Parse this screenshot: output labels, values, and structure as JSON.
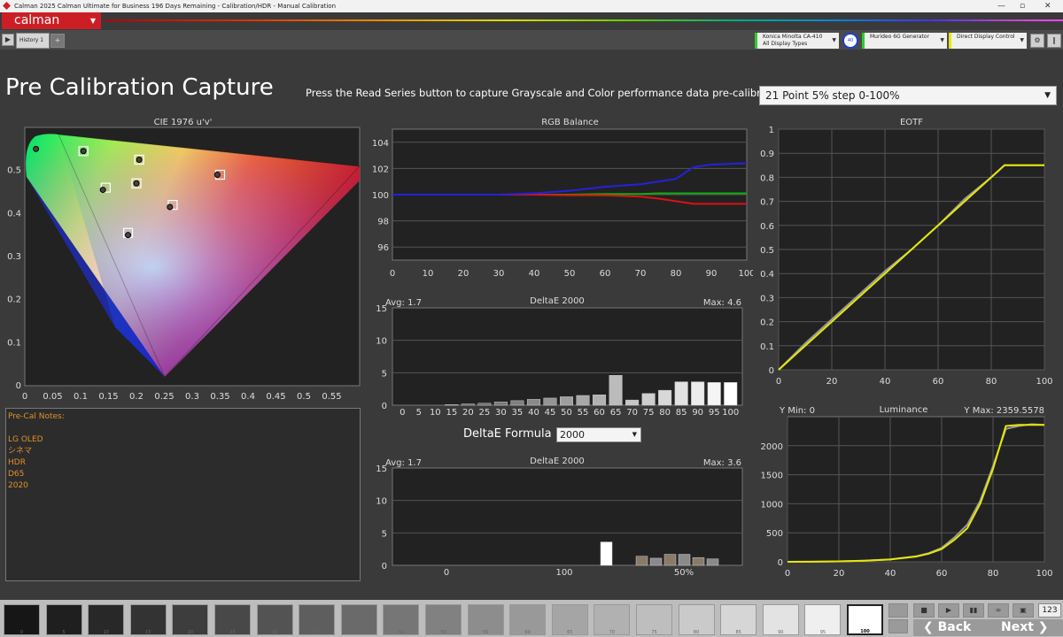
{
  "window": {
    "title": "Calman 2025 Calman Ultimate for Business 196 Days Remaining  - Calibration/HDR - Manual Calibration"
  },
  "brand": {
    "logo": "calman"
  },
  "tabs": [
    {
      "label": "History 1"
    }
  ],
  "devices": [
    {
      "line1": "Konica Minolta CA-410",
      "line2": "All Display Types",
      "color": "#2ecc2e"
    },
    {
      "line1": "Murideo 6G Generator",
      "line2": "",
      "color": "#2ecc2e"
    },
    {
      "line1": "Direct Display Control",
      "line2": "",
      "color": "#e6e60a"
    }
  ],
  "page": {
    "title": "Pre Calibration Capture",
    "instruction": "Press the Read Series button to capture Grayscale and Color performance data pre-calibration.",
    "series_selected": "21 Point 5% step 0-100%"
  },
  "cie": {
    "title": "CIE 1976 u'v'",
    "x_ticks": [
      "0",
      "0.05",
      "0.1",
      "0.15",
      "0.2",
      "0.25",
      "0.3",
      "0.35",
      "0.4",
      "0.45",
      "0.5",
      "0.55"
    ],
    "y_ticks": [
      "0",
      "0.1",
      "0.2",
      "0.3",
      "0.4",
      "0.5"
    ]
  },
  "rgb_balance": {
    "title": "RGB Balance",
    "x_ticks": [
      "0",
      "10",
      "20",
      "30",
      "40",
      "50",
      "60",
      "70",
      "80",
      "90",
      "100"
    ],
    "y_ticks": [
      "96",
      "98",
      "100",
      "102",
      "104"
    ]
  },
  "deltae1": {
    "title": "DeltaE 2000",
    "avg": "Avg: 1.7",
    "max": "Max: 4.6",
    "y_ticks": [
      "0",
      "5",
      "10",
      "15"
    ],
    "x_ticks": [
      "0",
      "5",
      "10",
      "15",
      "20",
      "25",
      "30",
      "35",
      "40",
      "45",
      "50",
      "55",
      "60",
      "65",
      "70",
      "75",
      "80",
      "85",
      "90",
      "95",
      "100"
    ]
  },
  "formula": {
    "label": "DeltaE Formula",
    "value": "2000"
  },
  "deltae2": {
    "title": "DeltaE 2000",
    "avg": "Avg: 1.7",
    "max": "Max: 3.6",
    "y_ticks": [
      "0",
      "5",
      "10",
      "15"
    ],
    "x_ticks": [
      "0",
      "100",
      "50%"
    ]
  },
  "eotf": {
    "title": "EOTF",
    "x_ticks": [
      "0",
      "20",
      "40",
      "60",
      "80",
      "100"
    ],
    "y_ticks": [
      "0",
      "0.1",
      "0.2",
      "0.3",
      "0.4",
      "0.5",
      "0.6",
      "0.7",
      "0.8",
      "0.9",
      "1"
    ]
  },
  "luminance": {
    "title": "Luminance",
    "ymin": "Y Min: 0",
    "ymax": "Y Max: 2359.5578",
    "x_ticks": [
      "0",
      "20",
      "40",
      "60",
      "80",
      "100"
    ],
    "y_ticks": [
      "0",
      "500",
      "1000",
      "1500",
      "2000"
    ]
  },
  "notes": {
    "heading": "Pre-Cal Notes:",
    "lines": [
      "LG OLED",
      "シネマ",
      "HDR",
      "D65",
      "2020"
    ]
  },
  "swatches": [
    "0",
    "5",
    "10",
    "15",
    "20",
    "25",
    "30",
    "35",
    "40",
    "45",
    "50",
    "55",
    "60",
    "65",
    "70",
    "75",
    "80",
    "85",
    "90",
    "95",
    "100"
  ],
  "nav": {
    "back": "Back",
    "next": "Next",
    "counter": "123"
  },
  "chart_data": [
    {
      "type": "line",
      "title": "RGB Balance",
      "x": [
        0,
        10,
        20,
        30,
        40,
        50,
        60,
        70,
        75,
        80,
        85,
        90,
        100
      ],
      "ylim": [
        95,
        105
      ],
      "series": [
        {
          "values": [
            100,
            100,
            100,
            100,
            100.1,
            100.3,
            100.6,
            100.8,
            101,
            101.2,
            102.1,
            102.3,
            102.4
          ],
          "color": "#2222dd"
        },
        {
          "values": [
            100,
            100,
            100,
            100,
            100,
            99.95,
            99.95,
            99.85,
            99.7,
            99.5,
            99.3,
            99.3,
            99.3
          ],
          "color": "#dd1111"
        },
        {
          "values": [
            100,
            100,
            100,
            100,
            100,
            100,
            100.05,
            100.05,
            100.1,
            100.1,
            100.1,
            100.1,
            100.1
          ],
          "color": "#11aa11"
        }
      ]
    },
    {
      "type": "bar",
      "title": "DeltaE 2000",
      "categories": [
        "0",
        "5",
        "10",
        "15",
        "20",
        "25",
        "30",
        "35",
        "40",
        "45",
        "50",
        "55",
        "60",
        "65",
        "70",
        "75",
        "80",
        "85",
        "90",
        "95",
        "100"
      ],
      "values": [
        0,
        0,
        0,
        0.1,
        0.2,
        0.3,
        0.5,
        0.7,
        0.9,
        1.1,
        1.3,
        1.5,
        1.6,
        4.6,
        0.8,
        1.8,
        2.3,
        3.6,
        3.6,
        3.5,
        3.5
      ],
      "ylim": [
        0,
        15
      ]
    },
    {
      "type": "bar",
      "title": "DeltaE 2000",
      "values": [
        3.6,
        1.4,
        1.1,
        1.7,
        1.7,
        1.2,
        1.0
      ],
      "ylim": [
        0,
        15
      ]
    },
    {
      "type": "line",
      "title": "EOTF",
      "x": [
        0,
        10,
        20,
        30,
        40,
        50,
        60,
        70,
        80,
        85,
        90,
        100
      ],
      "xlim": [
        0,
        100
      ],
      "ylim": [
        0,
        1
      ],
      "series": [
        {
          "values": [
            0,
            0.1,
            0.2,
            0.3,
            0.4,
            0.5,
            0.6,
            0.7,
            0.8,
            0.85,
            0.85,
            0.85
          ],
          "color": "#e6e60a"
        },
        {
          "values": [
            0,
            0.11,
            0.21,
            0.31,
            0.41,
            0.5,
            0.6,
            0.71,
            0.8,
            0.85,
            0.85,
            0.85
          ],
          "color": "#999999"
        }
      ]
    },
    {
      "type": "line",
      "title": "Luminance",
      "x": [
        0,
        10,
        20,
        30,
        40,
        50,
        55,
        60,
        65,
        70,
        75,
        80,
        85,
        90,
        95,
        100
      ],
      "xlim": [
        0,
        100
      ],
      "ylim": [
        0,
        2500
      ],
      "series": [
        {
          "values": [
            0,
            2,
            8,
            20,
            40,
            90,
            140,
            220,
            380,
            580,
            1000,
            1600,
            2340,
            2360,
            2360,
            2360
          ],
          "color": "#e6e60a"
        },
        {
          "values": [
            0,
            2,
            8,
            20,
            42,
            95,
            150,
            240,
            420,
            640,
            1050,
            1650,
            2290,
            2340,
            2370,
            2360
          ],
          "color": "#999999"
        }
      ]
    },
    {
      "type": "scatter",
      "title": "CIE 1976 u'v'",
      "xlim": [
        0,
        0.6
      ],
      "ylim": [
        0,
        0.6
      ],
      "target_points": [
        {
          "x": 0.105,
          "y": 0.545
        },
        {
          "x": 0.205,
          "y": 0.525
        },
        {
          "x": 0.145,
          "y": 0.46
        },
        {
          "x": 0.2,
          "y": 0.47
        },
        {
          "x": 0.35,
          "y": 0.49
        },
        {
          "x": 0.265,
          "y": 0.42
        },
        {
          "x": 0.185,
          "y": 0.355
        }
      ],
      "measured_points": [
        {
          "x": 0.02,
          "y": 0.55
        },
        {
          "x": 0.105,
          "y": 0.545
        },
        {
          "x": 0.205,
          "y": 0.525
        },
        {
          "x": 0.14,
          "y": 0.455
        },
        {
          "x": 0.2,
          "y": 0.47
        },
        {
          "x": 0.345,
          "y": 0.49
        },
        {
          "x": 0.26,
          "y": 0.415
        },
        {
          "x": 0.185,
          "y": 0.35
        }
      ]
    }
  ]
}
